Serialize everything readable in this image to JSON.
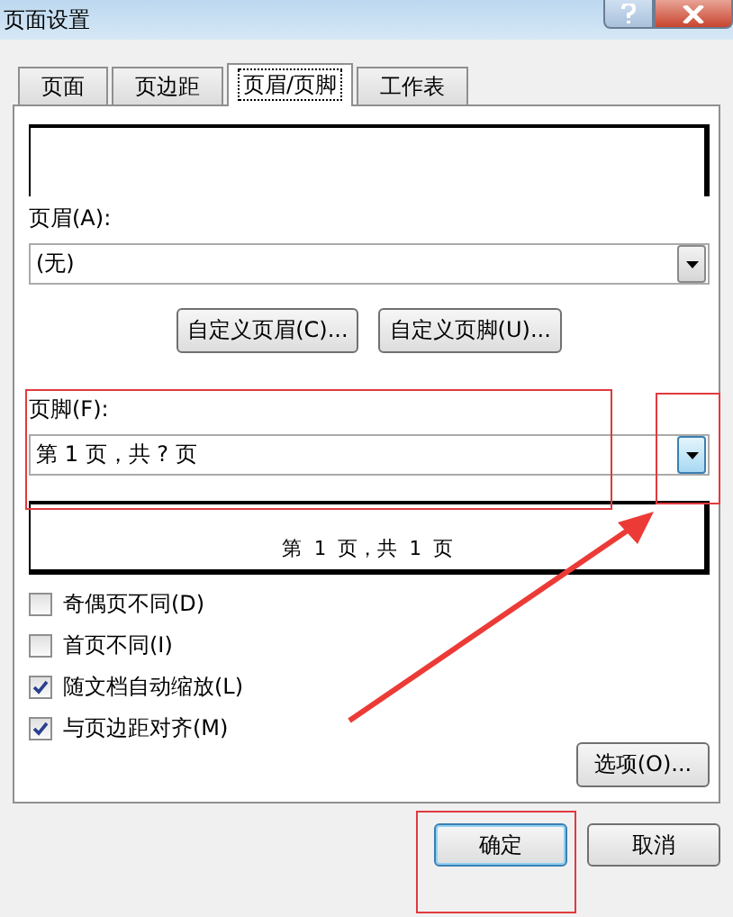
{
  "window": {
    "title": "页面设置"
  },
  "tabs": [
    {
      "label": "页面",
      "selected": false
    },
    {
      "label": "页边距",
      "selected": false
    },
    {
      "label": "页眉/页脚",
      "selected": true
    },
    {
      "label": "工作表",
      "selected": false
    }
  ],
  "header": {
    "label": "页眉(A):",
    "value": "(无)"
  },
  "custom_buttons": [
    "自定义页眉(C)...",
    "自定义页脚(U)..."
  ],
  "footer": {
    "label": "页脚(F):",
    "value": "第 1 页，共 ? 页",
    "preview": "第 1 页，共 1 页"
  },
  "options": [
    {
      "label": "奇偶页不同(D)",
      "checked": false
    },
    {
      "label": "首页不同(I)",
      "checked": false
    },
    {
      "label": "随文档自动缩放(L)",
      "checked": true
    },
    {
      "label": "与页边距对齐(M)",
      "checked": true
    }
  ],
  "options_button": "选项(O)...",
  "buttons": [
    {
      "label": "确定",
      "kind": "default"
    },
    {
      "label": "取消",
      "kind": "normal"
    }
  ]
}
